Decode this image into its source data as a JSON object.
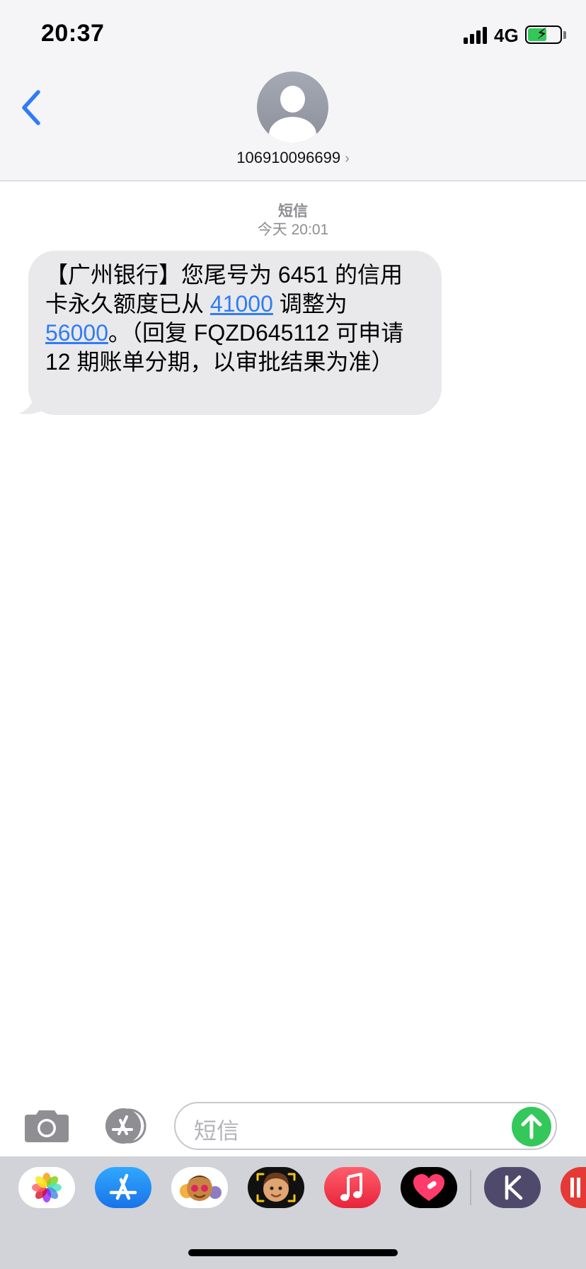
{
  "status_bar": {
    "time": "20:37",
    "network": "4G",
    "battery_level": 0.58,
    "battery_color": "#34c759"
  },
  "nav": {
    "contact_number": "106910096699"
  },
  "conversation": {
    "label": "短信",
    "timestamp": "今天 20:01",
    "message": {
      "part1": "【广州银行】您尾号为 6451 的信用卡永久额度已从 ",
      "link1": "41000",
      "part2": " 调整为 ",
      "link2": "56000",
      "part3": "。（回复 FQZD645112 可申请 12 期账单分期，以审批结果为准）"
    }
  },
  "input": {
    "placeholder": "短信"
  },
  "colors": {
    "accent": "#2f7cf6",
    "send_button": "#34c759",
    "bubble": "#e9e9eb"
  },
  "app_drawer": {
    "apps": [
      "photos-app",
      "app-store-app",
      "animoji-app",
      "memoji-app",
      "music-app",
      "digital-touch-app",
      "k-app",
      "partial-app"
    ]
  }
}
